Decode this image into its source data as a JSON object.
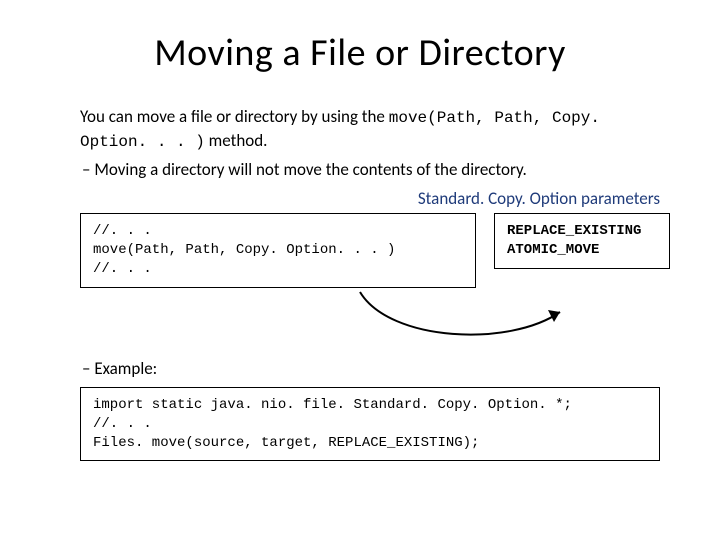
{
  "title": "Moving a File or Directory",
  "intro_pre": "You can move a file or directory by using the ",
  "intro_code": "move(Path, Path, Copy. Option. . . )",
  "intro_post": " method.",
  "bullet1": "Moving a directory will not move the contents of the directory.",
  "params_label": "Standard. Copy. Option parameters",
  "code1": {
    "l1": "//. . .",
    "l2": "move(Path, Path, Copy. Option. . . )",
    "l3": "//. . ."
  },
  "options": {
    "l1": "REPLACE_EXISTING",
    "l2": "ATOMIC_MOVE"
  },
  "bullet2": "Example:",
  "code2": {
    "l1": "import static java. nio. file. Standard. Copy. Option. *;",
    "l2": "//. . .",
    "l3": "Files. move(source, target, REPLACE_EXISTING);"
  }
}
